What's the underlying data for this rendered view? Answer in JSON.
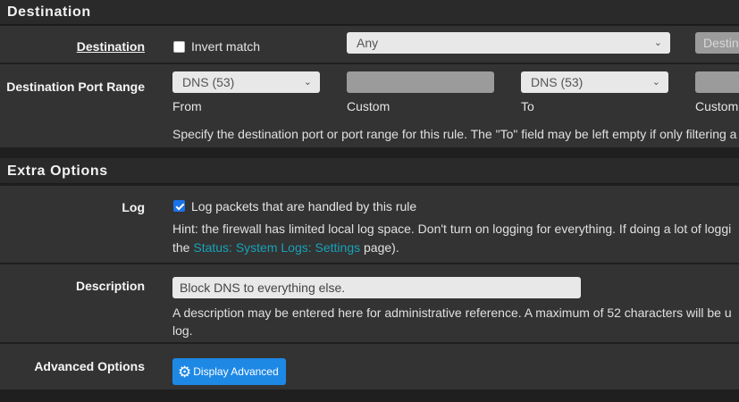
{
  "destination_panel": {
    "title": "Destination"
  },
  "destination": {
    "label": "Destination",
    "invert_label": "Invert match",
    "invert_checked": false,
    "type_value": "Any",
    "address_placeholder": "Destina"
  },
  "port_range": {
    "label": "Destination Port Range",
    "from_value": "DNS (53)",
    "from_label": "From",
    "custom_from_label": "Custom",
    "to_value": "DNS (53)",
    "to_label": "To",
    "custom_to_label": "Custom",
    "help": "Specify the destination port or port range for this rule. The \"To\" field may be left empty if only filtering a"
  },
  "extra_panel": {
    "title": "Extra Options"
  },
  "log": {
    "label": "Log",
    "checkbox_label": "Log packets that are handled by this rule",
    "checked": true,
    "hint_line1": "Hint: the firewall has limited local log space. Don't turn on logging for everything. If doing a lot of loggi",
    "hint_prefix": "the",
    "hint_link": "Status: System Logs: Settings",
    "hint_suffix": "page)."
  },
  "description": {
    "label": "Description",
    "value": "Block DNS to everything else.",
    "help_line1": "A description may be entered here for administrative reference. A maximum of 52 characters will be u",
    "help_line2": "log."
  },
  "advanced": {
    "label": "Advanced Options",
    "button_label": "Display Advanced"
  },
  "colors": {
    "accent": "#1e88e5",
    "link": "#17a2b8",
    "panel_header": "#2a2a2a",
    "row_bg": "#333333"
  }
}
